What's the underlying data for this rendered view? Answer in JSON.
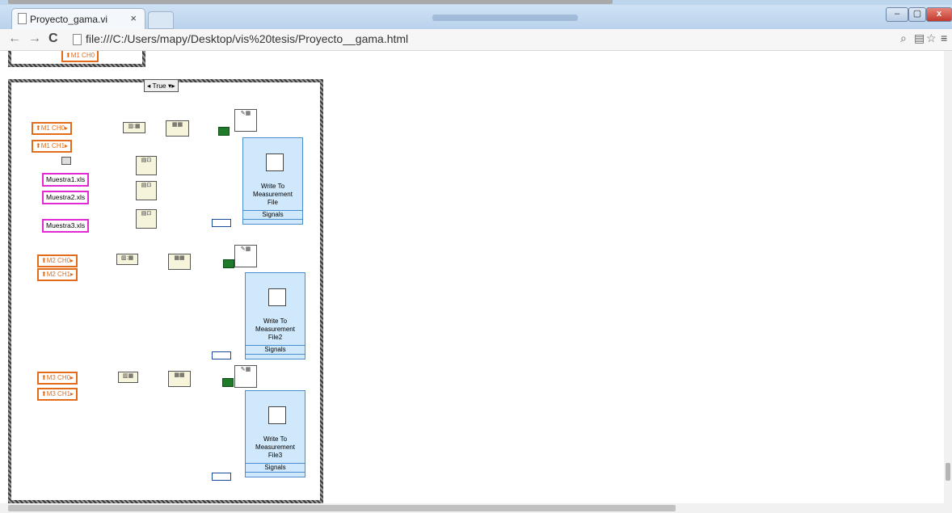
{
  "browser": {
    "tab_title": "Proyecto_gama.vi",
    "tab_close": "×",
    "url": "file:///C:/Users/mapy/Desktop/vis%20tesis/Proyecto__gama.html",
    "window_min": "–",
    "window_max": "▢",
    "window_close": "x"
  },
  "diagram": {
    "top_control": "M1 CH0",
    "case_selector": "True",
    "controls": [
      "M1 CH0",
      "M1 CH1",
      "M2 CH0",
      "M2 CH1",
      "M3 CH0",
      "M3 CH1"
    ],
    "paths": [
      "Muestra1.xls",
      "Muestra2.xls",
      "Muestra3.xls"
    ],
    "express_vis": [
      {
        "lines": [
          "Write To",
          "Measurement",
          "File"
        ],
        "signals": "Signals"
      },
      {
        "lines": [
          "Write To",
          "Measurement",
          "File2"
        ],
        "signals": "Signals"
      },
      {
        "lines": [
          "Write To",
          "Measurement",
          "File3"
        ],
        "signals": "Signals"
      }
    ]
  },
  "colors": {
    "wire_orange": "#e36c1b",
    "wire_teal": "#2e6f74",
    "wire_pink": "#e22ad4",
    "express_bg": "#cfe8fb"
  }
}
